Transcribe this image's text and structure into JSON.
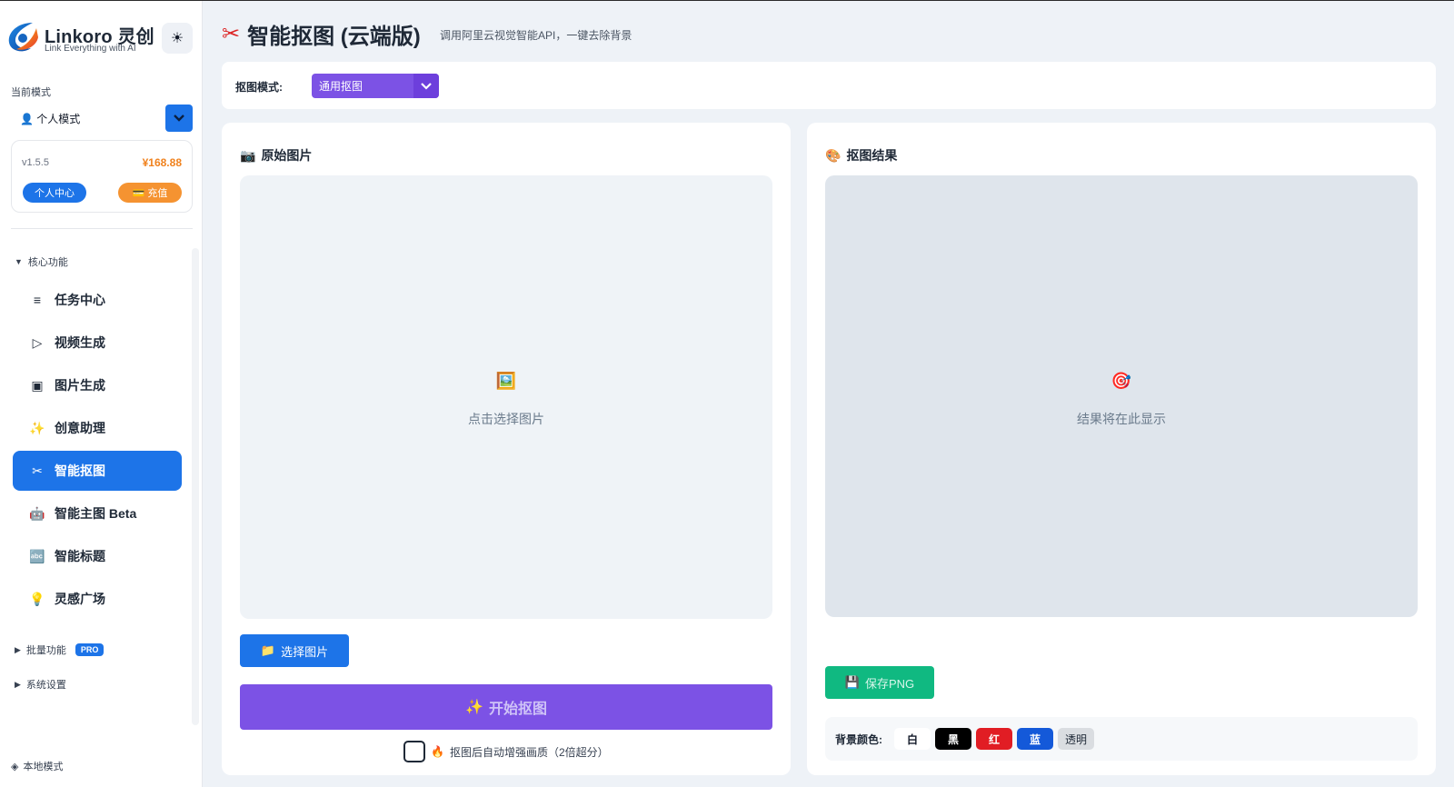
{
  "app": {
    "brand_name": "Linkoro 灵创",
    "brand_tagline": "Link Everything with AI",
    "theme_icon": "sun-icon"
  },
  "sidebar": {
    "mode_label": "当前模式",
    "mode_value": "👤 个人模式",
    "version": "v1.5.5",
    "balance": "¥168.88",
    "profile_button": "个人中心",
    "recharge_button": "充值",
    "groups": {
      "core": "核心功能",
      "batch": "批量功能",
      "batch_badge": "PRO",
      "settings": "系统设置"
    },
    "items": [
      {
        "label": "任务中心",
        "icon": "≡"
      },
      {
        "label": "视频生成",
        "icon": "▷"
      },
      {
        "label": "图片生成",
        "icon": "▣"
      },
      {
        "label": "创意助理",
        "icon": "✨"
      },
      {
        "label": "智能抠图",
        "icon": "✂"
      },
      {
        "label": "智能主图 Beta",
        "icon": "🤖"
      },
      {
        "label": "智能标题",
        "icon": "🔤"
      },
      {
        "label": "灵感广场",
        "icon": "💡"
      }
    ],
    "active_index": 4,
    "local_mode": "本地模式"
  },
  "header": {
    "title": "智能抠图 (云端版)",
    "subtitle": "调用阿里云视觉智能API，一键去除背景"
  },
  "mode_bar": {
    "label": "抠图模式:",
    "selected": "通用抠图"
  },
  "left_panel": {
    "title": "原始图片",
    "title_icon": "📷",
    "placeholder_icon": "🖼️",
    "placeholder_text": "点击选择图片",
    "select_button": "选择图片",
    "select_icon": "📁",
    "start_button": "开始抠图",
    "start_icon": "✨",
    "enhance_icon": "🔥",
    "enhance_label": "抠图后自动增强画质（2倍超分）"
  },
  "right_panel": {
    "title": "抠图结果",
    "title_icon": "🎨",
    "placeholder_icon": "🎯",
    "placeholder_text": "结果将在此显示",
    "save_button": "保存PNG",
    "save_icon": "💾",
    "bg_label": "背景颜色:",
    "bg_options": [
      "白",
      "黑",
      "红",
      "蓝",
      "透明"
    ]
  },
  "colors": {
    "primary": "#1d74e8",
    "purple": "#7c52e5",
    "orange": "#f59331",
    "green": "#10b981",
    "red": "#e11d24"
  }
}
